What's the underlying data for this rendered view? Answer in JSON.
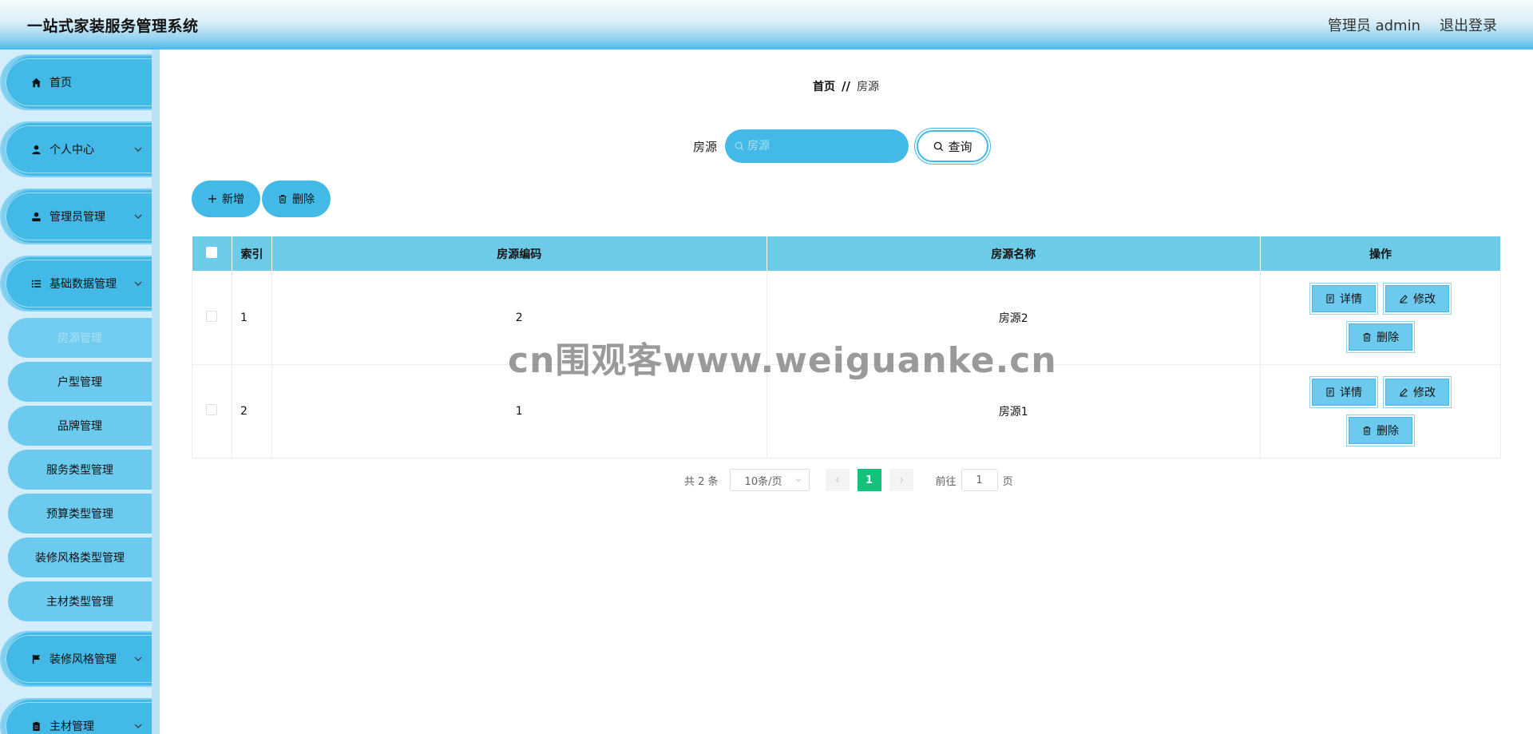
{
  "header": {
    "title": "一站式家装服务管理系统",
    "user_label": "管理员 admin",
    "logout_label": "退出登录"
  },
  "sidebar": {
    "items": [
      {
        "label": "首页",
        "icon": "home-icon"
      },
      {
        "label": "个人中心",
        "icon": "user-icon"
      },
      {
        "label": "管理员管理",
        "icon": "admin-icon"
      },
      {
        "label": "基础数据管理",
        "icon": "list-icon"
      },
      {
        "label": "装修风格管理",
        "icon": "flag-icon"
      },
      {
        "label": "主材管理",
        "icon": "clipboard-icon"
      }
    ],
    "sub_items": [
      {
        "label": "房源管理",
        "active": true
      },
      {
        "label": "户型管理"
      },
      {
        "label": "品牌管理"
      },
      {
        "label": "服务类型管理"
      },
      {
        "label": "预算类型管理"
      },
      {
        "label": "装修风格类型管理"
      },
      {
        "label": "主材类型管理"
      }
    ]
  },
  "breadcrumb": {
    "home": "首页",
    "separator": "//",
    "current": "房源"
  },
  "search": {
    "label": "房源",
    "placeholder": "房源",
    "button_label": "查询"
  },
  "toolbar": {
    "add_label": "新增",
    "delete_label": "删除"
  },
  "table": {
    "columns": [
      "索引",
      "房源编码",
      "房源名称",
      "操作"
    ],
    "rows": [
      {
        "index": "1",
        "code": "2",
        "name": "房源2"
      },
      {
        "index": "2",
        "code": "1",
        "name": "房源1"
      }
    ],
    "actions": {
      "detail": "详情",
      "edit": "修改",
      "delete": "删除"
    }
  },
  "pagination": {
    "total_text": "共 2 条",
    "page_size": "10条/页",
    "current_page": "1",
    "goto_prefix": "前往",
    "goto_value": "1",
    "goto_suffix": "页"
  },
  "watermark": "cn围观客www.weiguanke.cn",
  "colors": {
    "primary": "#42b9e7",
    "table_header": "#6ecbe8",
    "pagination_active": "#13c17a",
    "sidebar_bg": "#d3eefa"
  }
}
